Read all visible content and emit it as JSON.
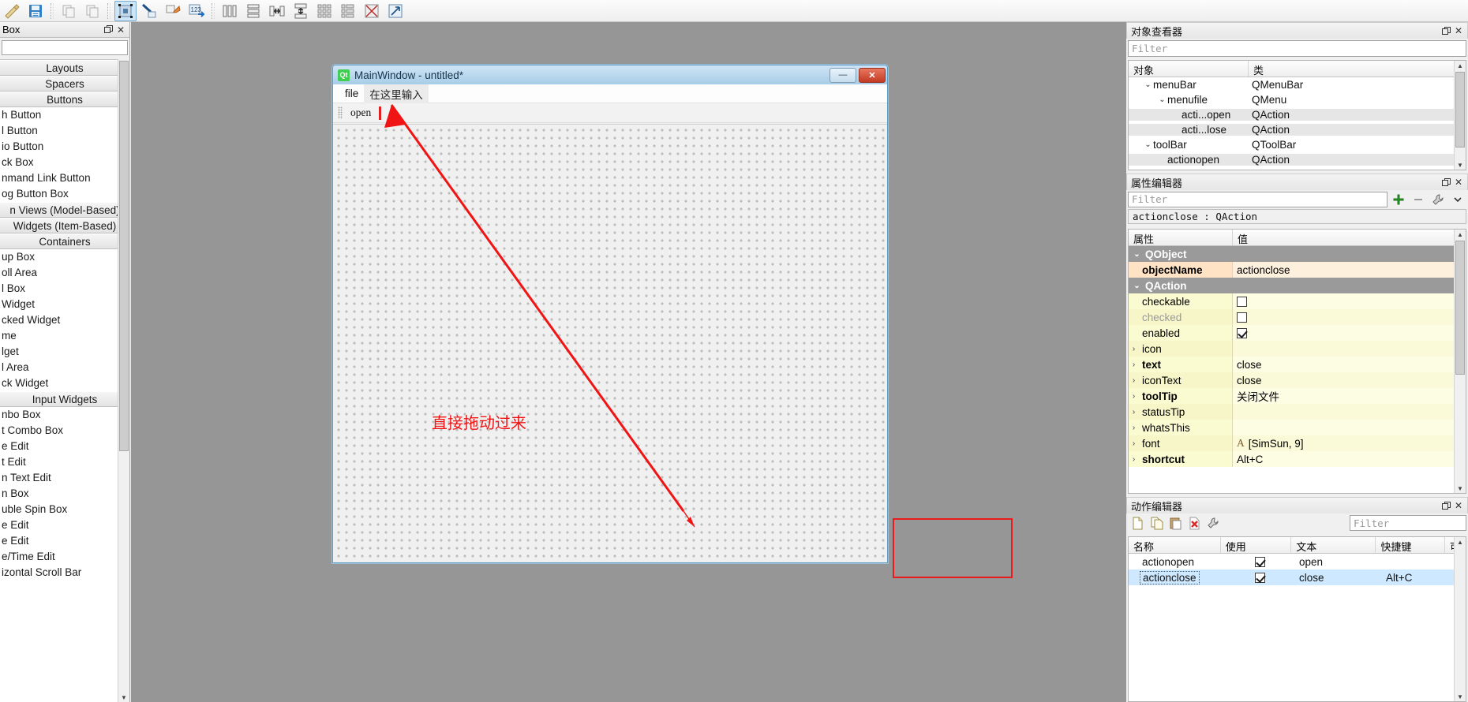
{
  "app": {
    "accent": "#e81c1c",
    "titlebar_blue": "#a8cde8"
  },
  "toolbar": {
    "buttons": [
      {
        "name": "edit-widgets",
        "label": "Edit Widgets",
        "active": true
      },
      {
        "name": "edit-signals-slots",
        "label": "Edit Signals/Slots",
        "active": false
      },
      {
        "name": "edit-buddies",
        "label": "Edit Buddies",
        "active": false
      },
      {
        "name": "edit-tab-order",
        "label": "Edit Tab Order",
        "active": false
      },
      {
        "name": "layout-vertically",
        "label": "Lay Out Vertically",
        "active": false
      },
      {
        "name": "layout-horizontally",
        "label": "Lay Out Horizontally",
        "active": false
      },
      {
        "name": "layout-splitter-h",
        "label": "Lay Out Horizontally in Splitter",
        "active": false
      },
      {
        "name": "layout-splitter-v",
        "label": "Lay Out Vertically in Splitter",
        "active": false
      },
      {
        "name": "layout-grid",
        "label": "Lay Out in a Grid",
        "active": false
      },
      {
        "name": "layout-form",
        "label": "Lay Out in a Form Layout",
        "active": false
      },
      {
        "name": "break-layout",
        "label": "Break Layout",
        "active": false
      },
      {
        "name": "adjust-size",
        "label": "Adjust Size",
        "active": false
      }
    ]
  },
  "widget_box": {
    "title": "Box",
    "filter_placeholder": "",
    "groups": [
      {
        "label": "Layouts",
        "items": []
      },
      {
        "label": "Spacers",
        "items": []
      },
      {
        "label": "Buttons",
        "items": [
          "h Button",
          "l Button",
          "io Button",
          "ck Box",
          "nmand Link Button",
          "og Button Box"
        ]
      },
      {
        "label": "n Views (Model-Based)",
        "items": []
      },
      {
        "label": "Widgets (Item-Based)",
        "items": []
      },
      {
        "label": "Containers",
        "items": [
          "up Box",
          "oll Area",
          "l Box",
          " Widget",
          "cked Widget",
          "me",
          "lget",
          "l Area",
          "ck Widget"
        ]
      },
      {
        "label": "Input Widgets",
        "items": [
          "nbo Box",
          "t Combo Box",
          "e Edit",
          "t Edit",
          "n Text Edit",
          "n Box",
          "uble Spin Box",
          "e Edit",
          "e Edit",
          "e/Time Edit",
          "izontal Scroll Bar"
        ]
      }
    ]
  },
  "form": {
    "title": "MainWindow - untitled*",
    "logo_text": "Qt",
    "minimize_glyph": "—",
    "close_glyph": "✕",
    "menubar": [
      {
        "label": "file",
        "placeholder": false
      },
      {
        "label": "在这里输入",
        "placeholder": true
      }
    ],
    "toolbar_actions": [
      "open"
    ],
    "annotation_text": "直接拖动过来"
  },
  "object_inspector": {
    "title": "对象查看器",
    "filter_placeholder": "Filter",
    "columns": [
      "对象",
      "类"
    ],
    "rows": [
      {
        "name": "menuBar",
        "class": "QMenuBar",
        "indent": 1,
        "chevron": "v",
        "alt": false
      },
      {
        "name": "menufile",
        "class": "QMenu",
        "indent": 2,
        "chevron": "v",
        "alt": false
      },
      {
        "name": "acti...open",
        "class": "QAction",
        "indent": 3,
        "chevron": "",
        "alt": true
      },
      {
        "name": "acti...lose",
        "class": "QAction",
        "indent": 3,
        "chevron": "",
        "alt": true
      },
      {
        "name": "toolBar",
        "class": "QToolBar",
        "indent": 1,
        "chevron": "v",
        "alt": false
      },
      {
        "name": "actionopen",
        "class": "QAction",
        "indent": 2,
        "chevron": "",
        "alt": true
      }
    ]
  },
  "property_editor": {
    "title": "属性编辑器",
    "filter_placeholder": "Filter",
    "object_header": "actionclose : QAction",
    "columns": [
      "属性",
      "值"
    ],
    "tool_buttons": [
      {
        "name": "add-property-button",
        "glyph": "+",
        "color": "#2a9d2a"
      },
      {
        "name": "remove-property-button",
        "glyph": "−",
        "color": "#888888"
      },
      {
        "name": "configure-button",
        "glyph": "wrench",
        "color": "#6a6a6a"
      },
      {
        "name": "dropdown-button",
        "glyph": "▾",
        "color": "#444444"
      }
    ],
    "rows": [
      {
        "kind": "group",
        "name": "QObject",
        "value": "",
        "chevron": "v"
      },
      {
        "kind": "sel",
        "name": "objectName",
        "value": "actionclose",
        "bold": true,
        "chevron": ""
      },
      {
        "kind": "group",
        "name": "QAction",
        "value": "",
        "chevron": "v"
      },
      {
        "kind": "y1",
        "name": "checkable",
        "value": "",
        "checkbox": "off",
        "chevron": ""
      },
      {
        "kind": "y2",
        "name": "checked",
        "value": "",
        "checkbox": "off",
        "chevron": "",
        "dim": true
      },
      {
        "kind": "y1",
        "name": "enabled",
        "value": "",
        "checkbox": "on",
        "chevron": ""
      },
      {
        "kind": "y2",
        "name": "icon",
        "value": "",
        "chevron": ">"
      },
      {
        "kind": "y1",
        "name": "text",
        "value": "close",
        "bold": true,
        "chevron": ">"
      },
      {
        "kind": "y2",
        "name": "iconText",
        "value": "close",
        "chevron": ">"
      },
      {
        "kind": "y1",
        "name": "toolTip",
        "value": "关闭文件",
        "bold": true,
        "chevron": ">"
      },
      {
        "kind": "y2",
        "name": "statusTip",
        "value": "",
        "chevron": ">"
      },
      {
        "kind": "y1",
        "name": "whatsThis",
        "value": "",
        "chevron": ">"
      },
      {
        "kind": "y2",
        "name": "font",
        "value": "[SimSun, 9]",
        "font_icon": "A",
        "chevron": ">"
      },
      {
        "kind": "y1",
        "name": "shortcut",
        "value": "Alt+C",
        "bold": true,
        "chevron": ">"
      }
    ]
  },
  "action_editor": {
    "title": "动作编辑器",
    "filter_placeholder": "Filter",
    "tool_buttons": [
      {
        "name": "new-action-button",
        "glyph": "new"
      },
      {
        "name": "copy-action-button",
        "glyph": "copy"
      },
      {
        "name": "paste-action-button",
        "glyph": "paste"
      },
      {
        "name": "delete-action-button",
        "glyph": "delete"
      },
      {
        "name": "edit-action-button",
        "glyph": "edit"
      }
    ],
    "columns": [
      "名称",
      "使用",
      "文本",
      "快捷键",
      "可"
    ],
    "rows": [
      {
        "name": "actionopen",
        "used": true,
        "text": "open",
        "shortcut": "",
        "selected": false
      },
      {
        "name": "actionclose",
        "used": true,
        "text": "close",
        "shortcut": "Alt+C",
        "selected": true
      }
    ]
  }
}
